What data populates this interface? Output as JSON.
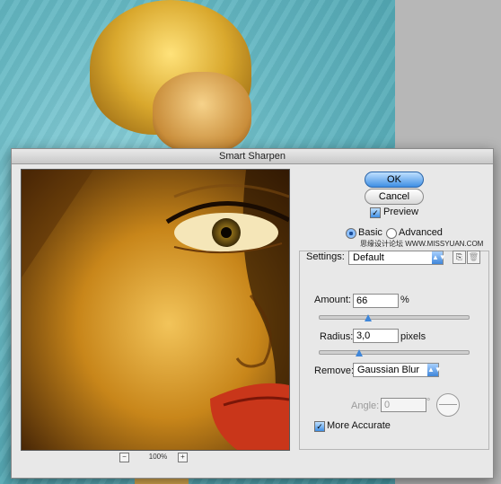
{
  "dialog": {
    "title": "Smart Sharpen",
    "ok_label": "OK",
    "cancel_label": "Cancel",
    "preview_label": "Preview",
    "zoom_minus": "−",
    "zoom_plus": "+",
    "zoom_value": "100%"
  },
  "mode": {
    "basic_label": "Basic",
    "advanced_label": "Advanced",
    "selected": "Basic"
  },
  "settings": {
    "label": "Settings:",
    "value": "Default"
  },
  "amount": {
    "label": "Amount:",
    "value": "66",
    "unit": "%",
    "slider_fraction": 0.33
  },
  "radius": {
    "label": "Radius:",
    "value": "3,0",
    "unit": "pixels",
    "slider_fraction": 0.27
  },
  "remove": {
    "label": "Remove:",
    "value": "Gaussian Blur"
  },
  "angle": {
    "label": "Angle:",
    "value": "0",
    "unit": "°"
  },
  "more_accurate": {
    "label": "More Accurate",
    "checked": true
  },
  "watermark": {
    "text": "思缘设计论坛 WWW.MISSYUAN.COM"
  },
  "colors": {
    "accent": "#3f86d9",
    "dialog_bg": "#e8e8e8"
  },
  "icons": [
    "save-settings-icon",
    "delete-settings-icon",
    "checkmark-icon",
    "dropdown-arrow-icon",
    "angle-dial-icon"
  ]
}
